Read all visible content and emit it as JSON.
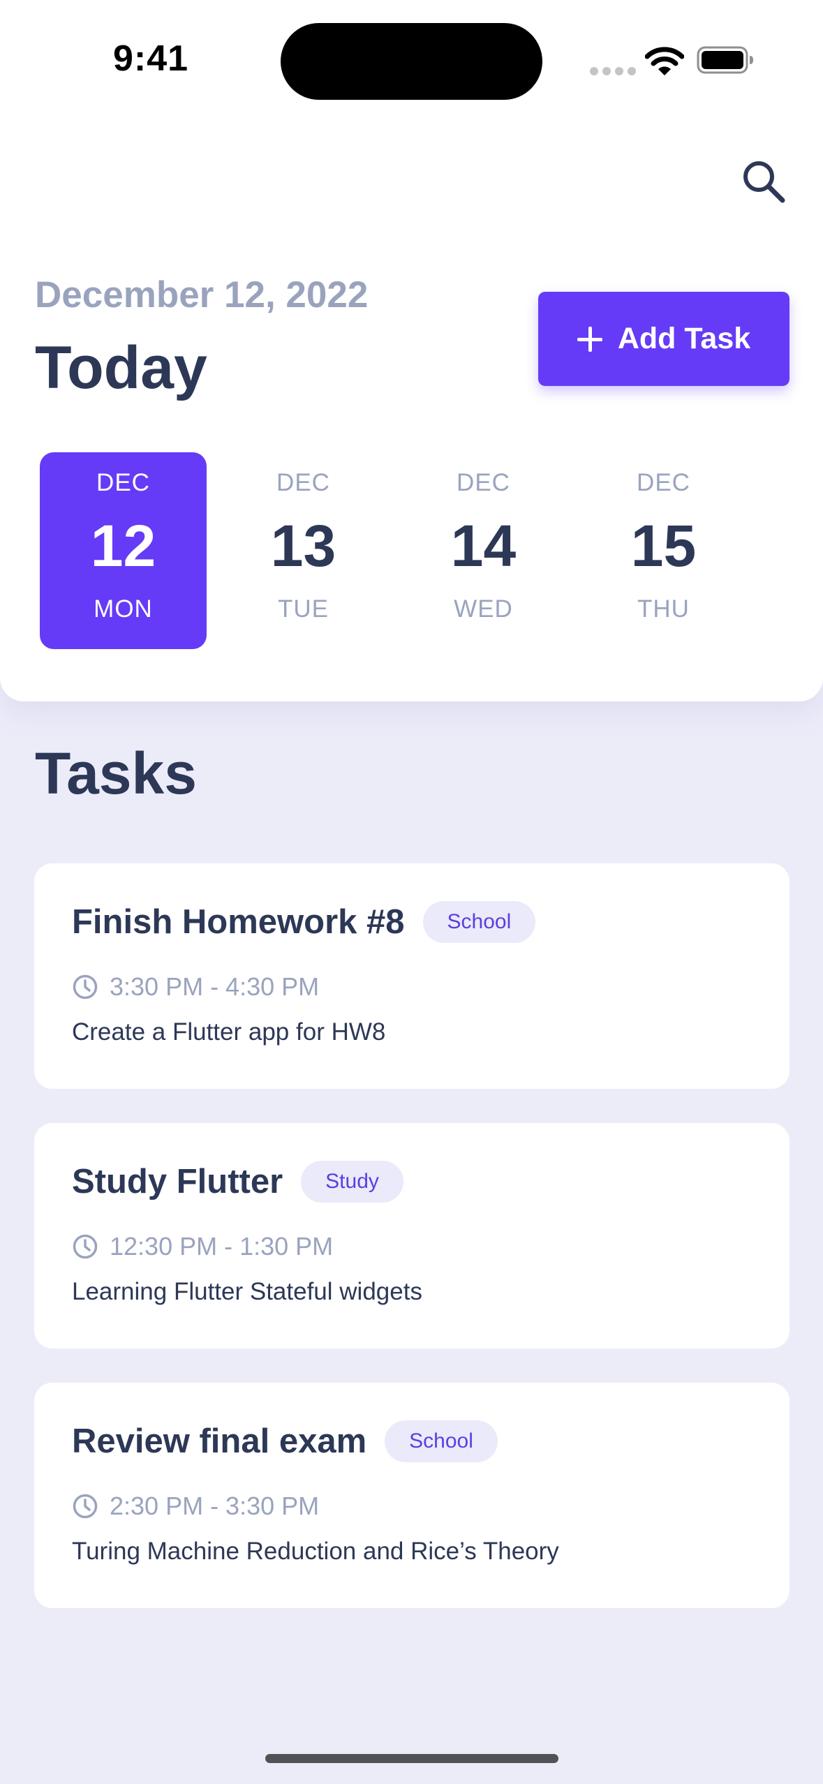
{
  "status_bar": {
    "time": "9:41"
  },
  "header": {
    "date": "December 12, 2022",
    "title": "Today",
    "add_task_label": "Add Task",
    "accent_color": "#653BF7"
  },
  "days": [
    {
      "month": "DEC",
      "day": "12",
      "weekday": "MON",
      "selected": true
    },
    {
      "month": "DEC",
      "day": "13",
      "weekday": "TUE",
      "selected": false
    },
    {
      "month": "DEC",
      "day": "14",
      "weekday": "WED",
      "selected": false
    },
    {
      "month": "DEC",
      "day": "15",
      "weekday": "THU",
      "selected": false
    }
  ],
  "tasks_section": {
    "title": "Tasks"
  },
  "tasks": [
    {
      "title": "Finish Homework #8",
      "tag": "School",
      "time": "3:30 PM - 4:30 PM",
      "description": "Create a Flutter app for HW8"
    },
    {
      "title": "Study Flutter",
      "tag": "Study",
      "time": "12:30 PM - 1:30 PM",
      "description": "Learning Flutter Stateful widgets"
    },
    {
      "title": "Review final exam",
      "tag": "School",
      "time": "2:30 PM - 3:30 PM",
      "description": "Turing Machine Reduction and Rice’s Theory"
    }
  ],
  "icons": [
    "search-icon",
    "plus-icon",
    "clock-icon",
    "wifi-icon",
    "battery-icon"
  ]
}
